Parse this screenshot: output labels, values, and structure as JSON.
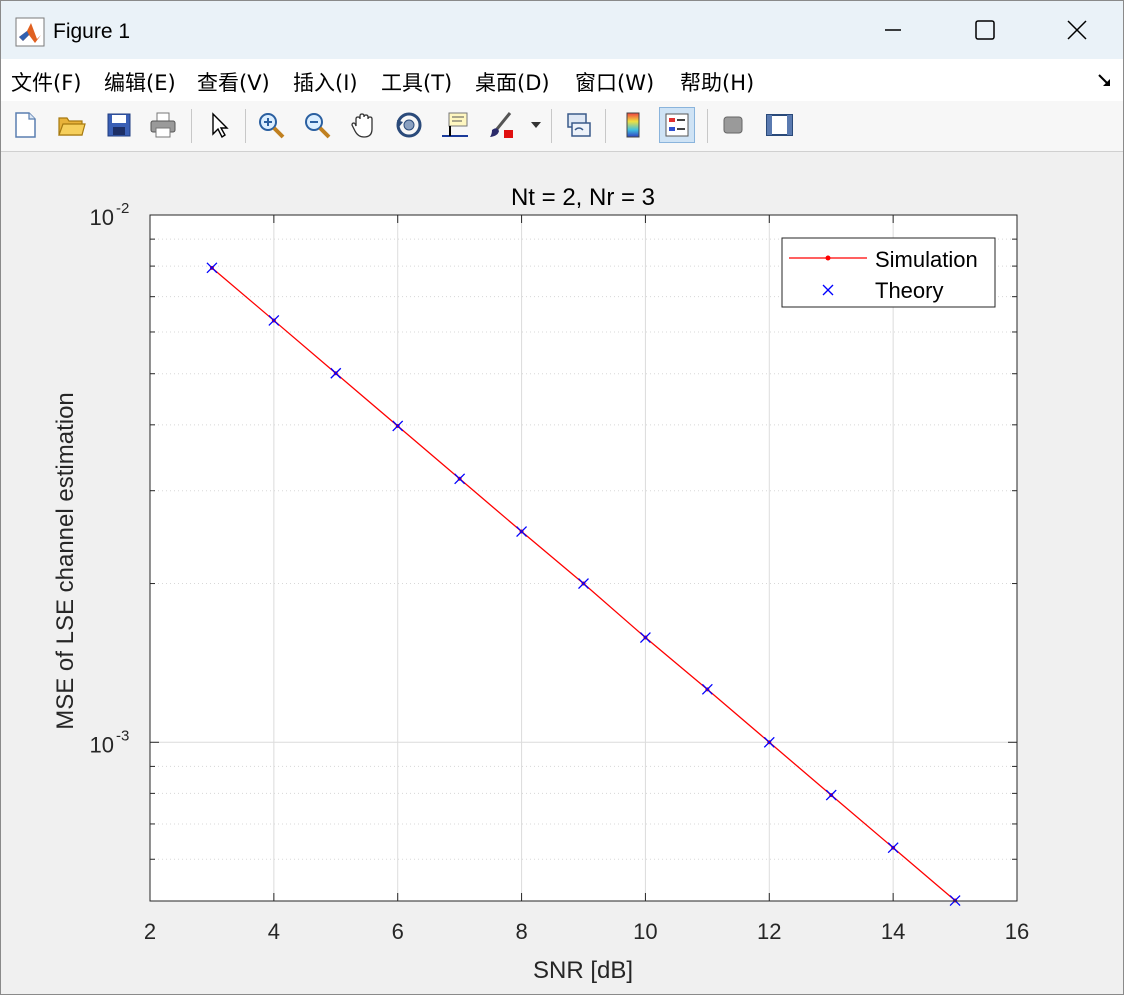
{
  "window": {
    "title": "Figure 1"
  },
  "menu": {
    "file": "文件(F)",
    "edit": "编辑(E)",
    "view": "查看(V)",
    "insert": "插入(I)",
    "tools": "工具(T)",
    "desktop": "桌面(D)",
    "window": "窗口(W)",
    "help": "帮助(H)"
  },
  "toolbar": {
    "icons": [
      "new-figure-icon",
      "open-file-icon",
      "save-icon",
      "print-icon",
      "select-arrow-icon",
      "zoom-in-icon",
      "zoom-out-icon",
      "pan-hand-icon",
      "rotate-3d-icon",
      "data-cursor-icon",
      "brush-icon",
      "link-plot-icon",
      "colorbar-icon",
      "legend-icon",
      "hide-plot-tools-icon",
      "show-plot-tools-icon"
    ]
  },
  "colors": {
    "simulation": "#ff0000",
    "theory": "#0000ff"
  },
  "chart_data": {
    "type": "line",
    "title": "Nt = 2, Nr = 3",
    "xlabel": "SNR [dB]",
    "ylabel": "MSE of LSE channel estimation",
    "xlim": [
      2,
      16
    ],
    "ylim": [
      0.0005,
      0.01
    ],
    "yscale": "log",
    "grid": true,
    "legend_position": "top-right",
    "x_ticks": [
      "2",
      "4",
      "6",
      "8",
      "10",
      "12",
      "14",
      "16"
    ],
    "y_tick_labels": [
      {
        "base": "10",
        "exp": "-2",
        "value": 0.01
      },
      {
        "base": "10",
        "exp": "-3",
        "value": 0.001
      }
    ],
    "x": [
      3,
      4,
      5,
      6,
      7,
      8,
      9,
      10,
      11,
      12,
      13,
      14,
      15
    ],
    "series": [
      {
        "name": "Simulation",
        "marker": "dot",
        "color": "#ff0000",
        "values": [
          0.00794,
          0.00631,
          0.00501,
          0.00398,
          0.00316,
          0.00251,
          0.002,
          0.00158,
          0.00126,
          0.001,
          0.000794,
          0.000631,
          0.000501
        ]
      },
      {
        "name": "Theory",
        "marker": "x",
        "color": "#0000ff",
        "values": [
          0.00794,
          0.00631,
          0.00501,
          0.00398,
          0.00316,
          0.00251,
          0.002,
          0.00158,
          0.00126,
          0.001,
          0.000794,
          0.000631,
          0.000501
        ]
      }
    ]
  }
}
